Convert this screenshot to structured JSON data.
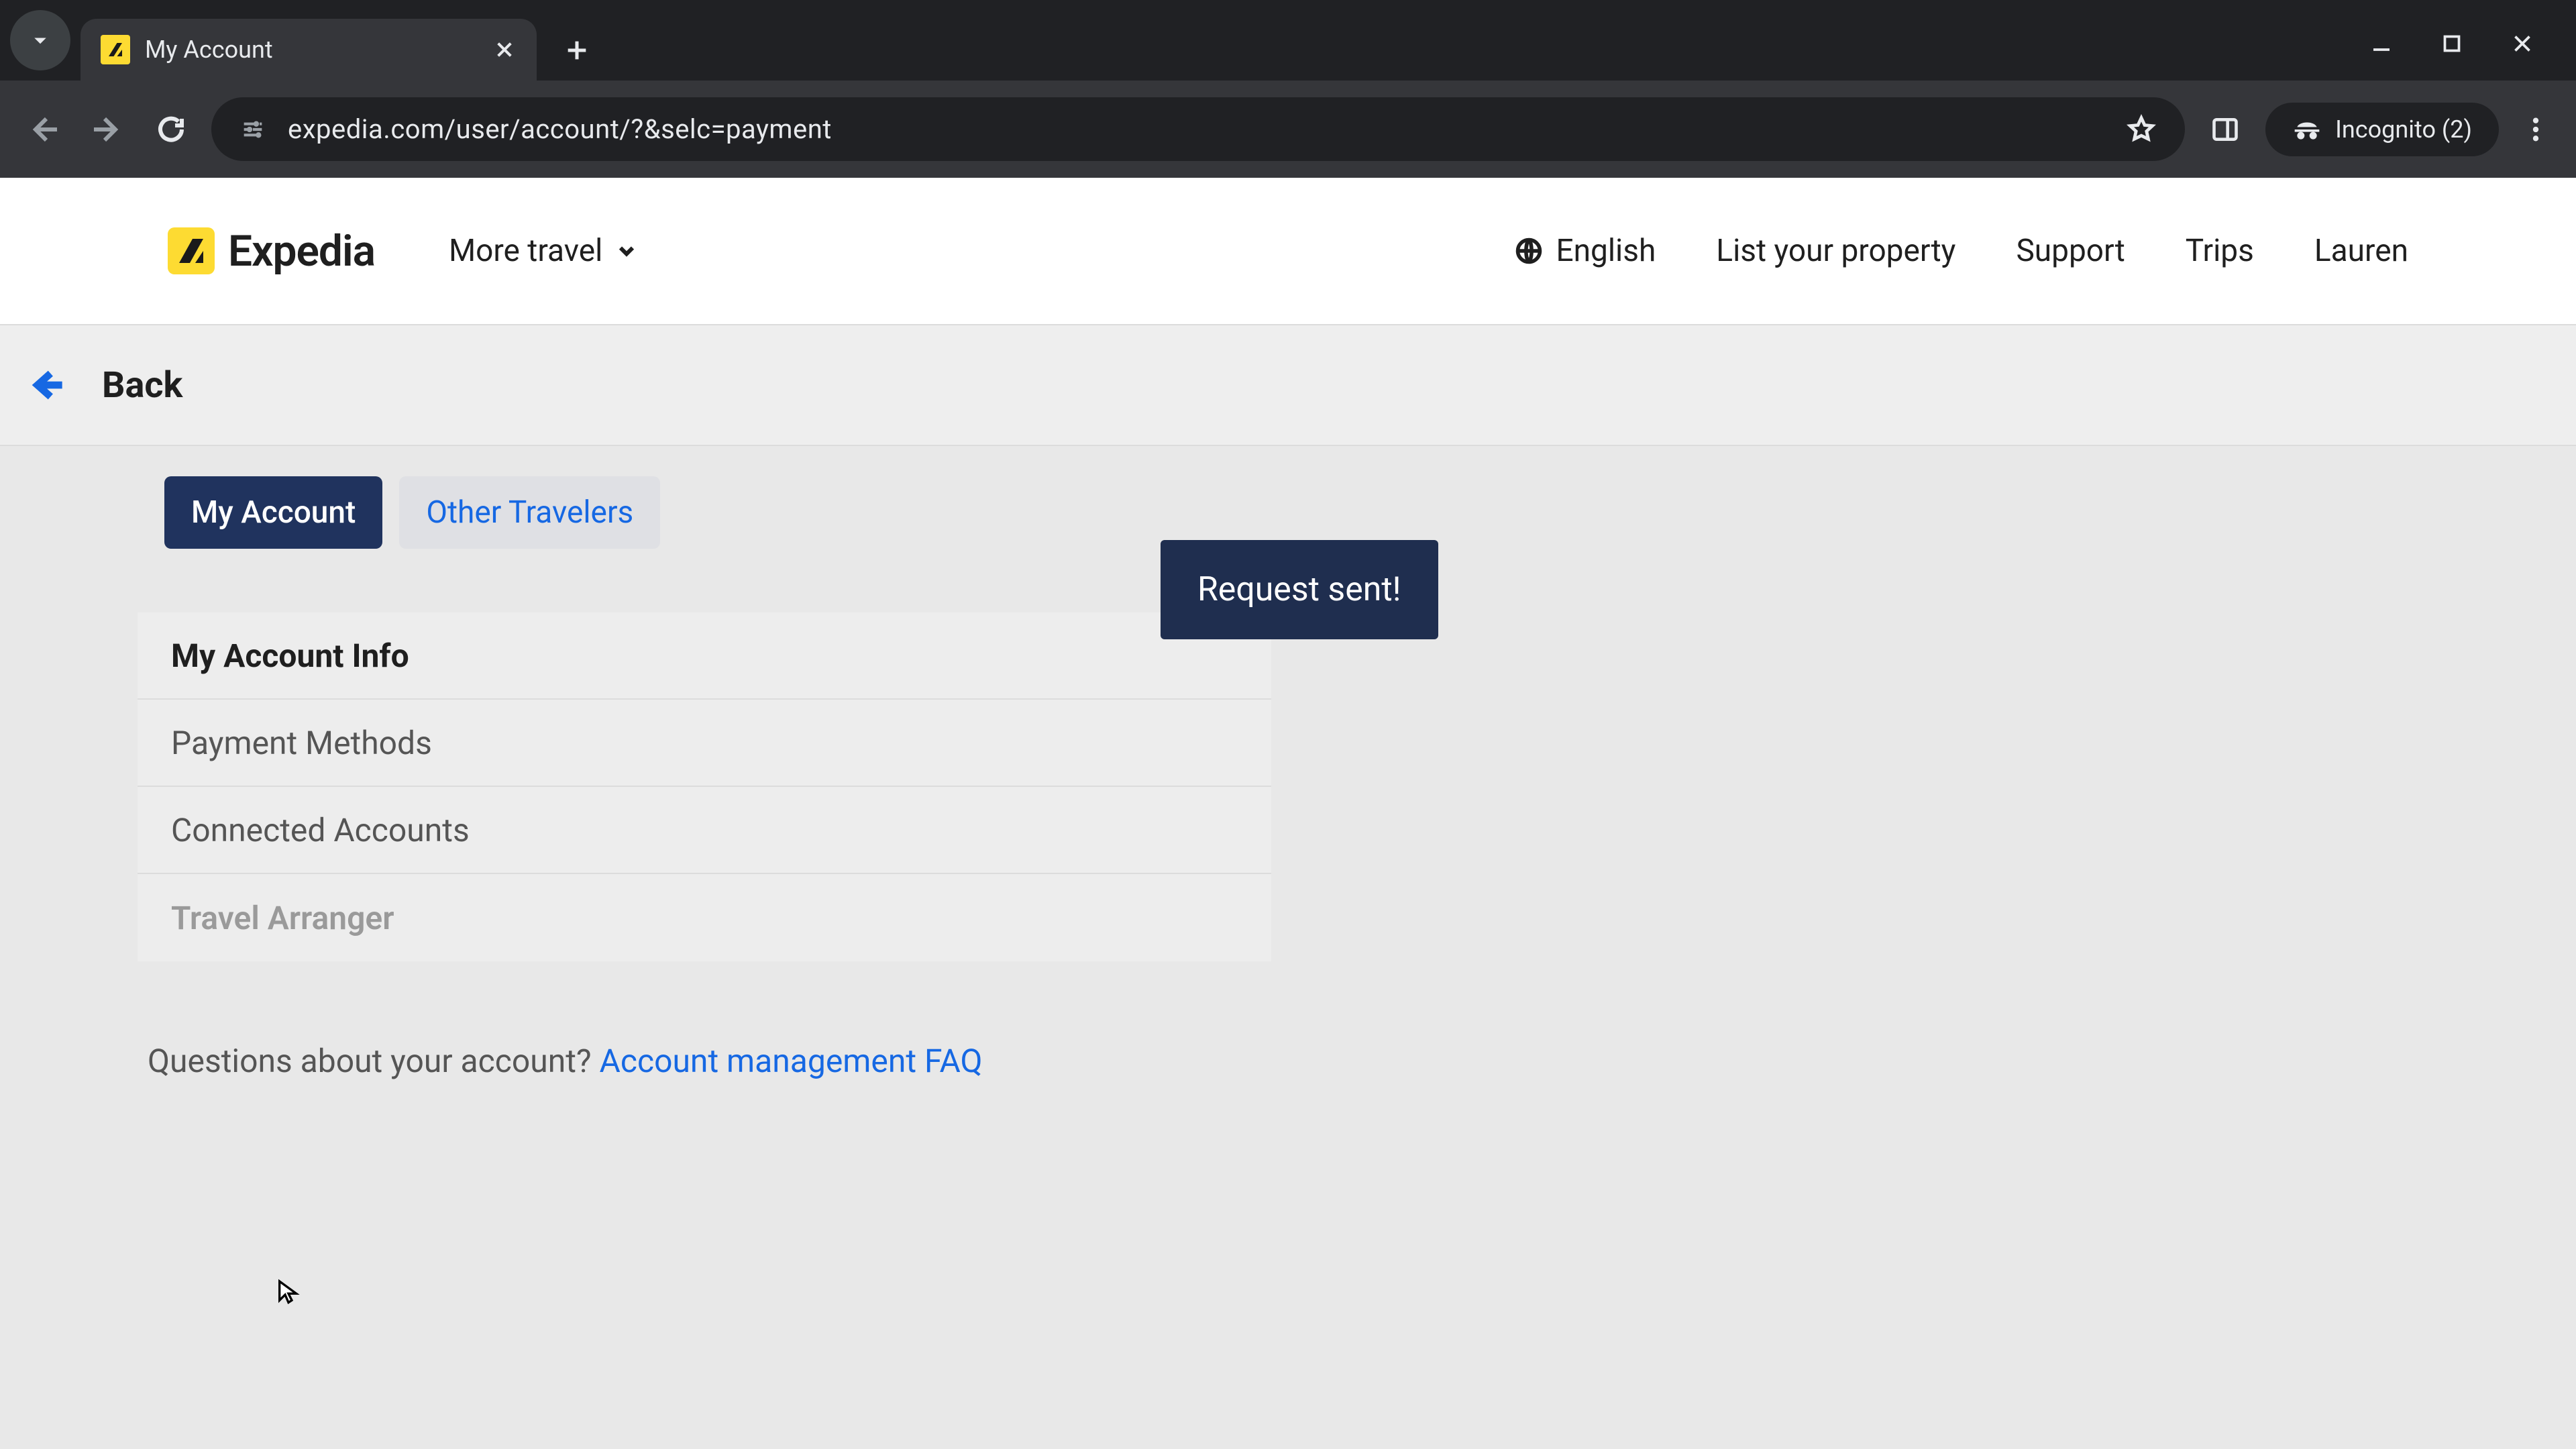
{
  "browser": {
    "tab_title": "My Account",
    "url": "expedia.com/user/account/?&selc=payment",
    "incognito_label": "Incognito (2)"
  },
  "header": {
    "brand": "Expedia",
    "more_travel": "More travel",
    "links": {
      "language": "English",
      "list_property": "List your property",
      "support": "Support",
      "trips": "Trips",
      "user": "Lauren"
    }
  },
  "back_bar": {
    "label": "Back"
  },
  "tabs": {
    "my_account": "My Account",
    "other_travelers": "Other Travelers"
  },
  "sections": {
    "account_info": "My Account Info",
    "payment_methods": "Payment Methods",
    "connected_accounts": "Connected Accounts",
    "travel_arranger": "Travel Arranger"
  },
  "faq": {
    "question": "Questions about your account? ",
    "link": "Account management FAQ"
  },
  "toast": {
    "message": "Request sent!"
  }
}
